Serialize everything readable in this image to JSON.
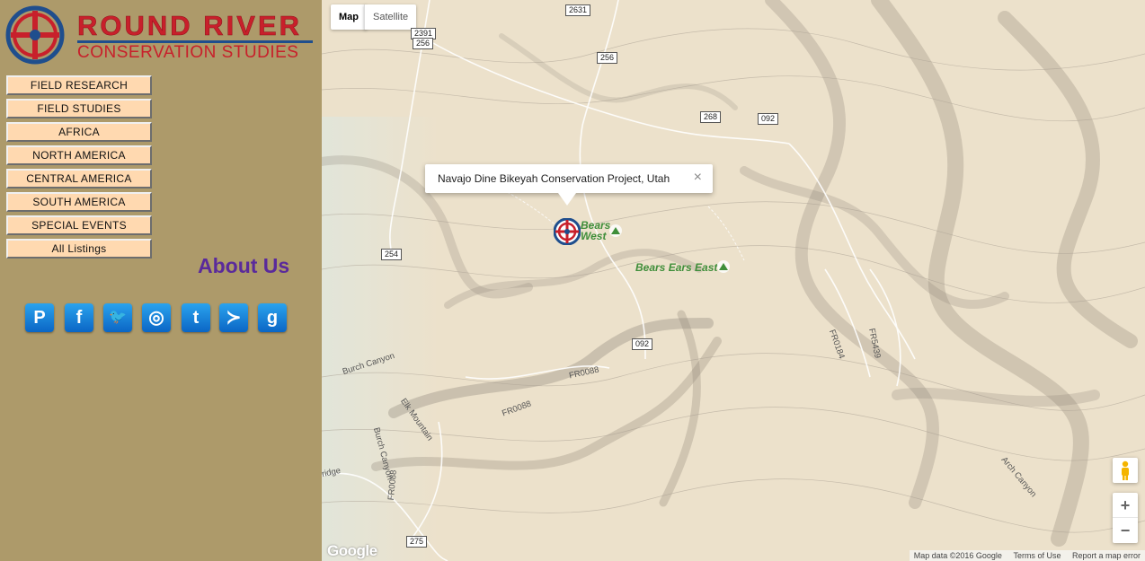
{
  "brand": {
    "line1": "ROUND RIVER",
    "line2": "CONSERVATION STUDIES",
    "colors": {
      "red": "#c8202b",
      "blue": "#1f4e8d"
    }
  },
  "menu": [
    {
      "label": "FIELD RESEARCH"
    },
    {
      "label": "FIELD STUDIES"
    },
    {
      "label": "AFRICA"
    },
    {
      "label": "NORTH AMERICA"
    },
    {
      "label": "CENTRAL AMERICA"
    },
    {
      "label": "SOUTH AMERICA"
    },
    {
      "label": "SPECIAL EVENTS"
    },
    {
      "label": "All Listings"
    }
  ],
  "about": {
    "title": "About Us"
  },
  "social": [
    {
      "icon": "pinterest-icon",
      "glyph": "P"
    },
    {
      "icon": "facebook-icon",
      "glyph": "f"
    },
    {
      "icon": "twitter-icon",
      "glyph": "🐦"
    },
    {
      "icon": "dribbble-icon",
      "glyph": "◎"
    },
    {
      "icon": "tumblr-icon",
      "glyph": "t"
    },
    {
      "icon": "delicious-icon",
      "glyph": "≻"
    },
    {
      "icon": "google-icon",
      "glyph": "g"
    }
  ],
  "map": {
    "type_buttons": {
      "map": "Map",
      "satellite": "Satellite"
    },
    "infowindow": {
      "text": "Navajo Dine Bikeyah Conservation Project, Utah",
      "close": "×"
    },
    "peaks": {
      "west_line1": "Bears",
      "west_line2": "West",
      "east": "Bears Ears East"
    },
    "shields": {
      "r2631": "2631",
      "r2391": "2391",
      "r256a": "256",
      "r256b": "256",
      "r268": "268",
      "r092a": "092",
      "r254": "254",
      "r092b": "092",
      "r275": "275"
    },
    "places": {
      "burch1": "Burch Canyon",
      "burch2": "Burch Canyon",
      "elk": "Elk Mountain",
      "fr0088a": "FR0088",
      "fr0088b": "FR0088",
      "fr0088c": "FR0088",
      "fr0184": "FR0184",
      "fr5439": "FR5439",
      "arch": "Arch Canyon",
      "ridge": "ridge"
    },
    "zoom": {
      "in": "+",
      "out": "−"
    },
    "google": "Google",
    "attribution": {
      "data": "Map data ©2016 Google",
      "terms": "Terms of Use",
      "report": "Report a map error"
    }
  }
}
